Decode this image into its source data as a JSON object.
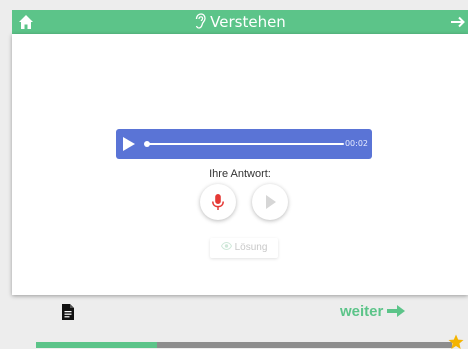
{
  "header": {
    "title": "Verstehen",
    "home_icon": "home-icon",
    "title_icon": "ear-icon",
    "next_icon": "arrow-right-icon",
    "color": "#5cc489"
  },
  "player": {
    "time": "00:02",
    "progress": 0.0,
    "color": "#5a74d6"
  },
  "answer": {
    "label": "Ihre Antwort:",
    "mic_icon": "microphone-icon",
    "play_icon": "play-icon"
  },
  "solution": {
    "label": "Lösung",
    "icon": "eye-icon"
  },
  "footer": {
    "doc_icon": "document-icon",
    "next_label": "weiter",
    "next_icon": "arrow-right-icon",
    "progress": 0.29,
    "star_icon": "star-icon",
    "progress_color": "#5cc489",
    "star_color": "#f4b400"
  }
}
